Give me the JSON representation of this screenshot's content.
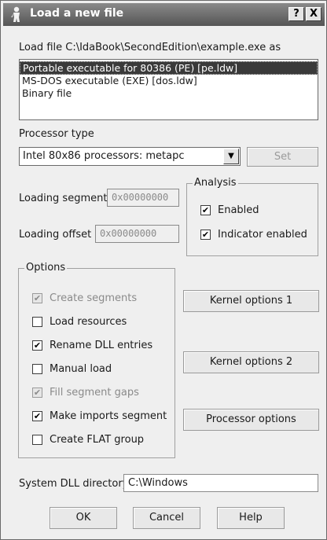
{
  "window": {
    "title": "Load a new file",
    "help_button": "?",
    "close_button": "X"
  },
  "load_file_label": "Load file C:\\IdaBook\\SecondEdition\\example.exe as",
  "file_types": [
    "Portable executable for 80386 (PE) [pe.ldw]",
    "MS-DOS executable (EXE) [dos.ldw]",
    "Binary file"
  ],
  "selected_file_type": "Portable executable for 80386 (PE) [pe.ldw]",
  "processor": {
    "label": "Processor type",
    "value": "Intel 80x86 processors: metapc",
    "set_button": "Set"
  },
  "loading_segment": {
    "label": "Loading segment",
    "value": "0x00000000"
  },
  "loading_offset": {
    "label": "Loading offset",
    "value": "0x00000000"
  },
  "analysis": {
    "title": "Analysis",
    "options": [
      {
        "label": "Enabled",
        "checked": true,
        "enabled": true
      },
      {
        "label": "Indicator enabled",
        "checked": true,
        "enabled": true
      }
    ]
  },
  "options": {
    "title": "Options",
    "items": [
      {
        "label": "Create segments",
        "checked": true,
        "enabled": false
      },
      {
        "label": "Load resources",
        "checked": false,
        "enabled": true
      },
      {
        "label": "Rename DLL entries",
        "checked": true,
        "enabled": true
      },
      {
        "label": "Manual load",
        "checked": false,
        "enabled": true
      },
      {
        "label": "Fill segment gaps",
        "checked": true,
        "enabled": false
      },
      {
        "label": "Make imports segment",
        "checked": true,
        "enabled": true
      },
      {
        "label": "Create FLAT group",
        "checked": false,
        "enabled": true
      }
    ]
  },
  "side_buttons": {
    "kernel1": "Kernel options 1",
    "kernel2": "Kernel options 2",
    "processor": "Processor options"
  },
  "dll_directory": {
    "label": "System DLL directory",
    "value": "C:\\Windows"
  },
  "footer": {
    "ok": "OK",
    "cancel": "Cancel",
    "help": "Help"
  },
  "check_mark": "✔",
  "icons": {
    "title": "ida-person-icon"
  },
  "colors": {
    "title_bar": "#555555",
    "selection": "#3a3a3a",
    "dialog_bg": "#efefef"
  }
}
